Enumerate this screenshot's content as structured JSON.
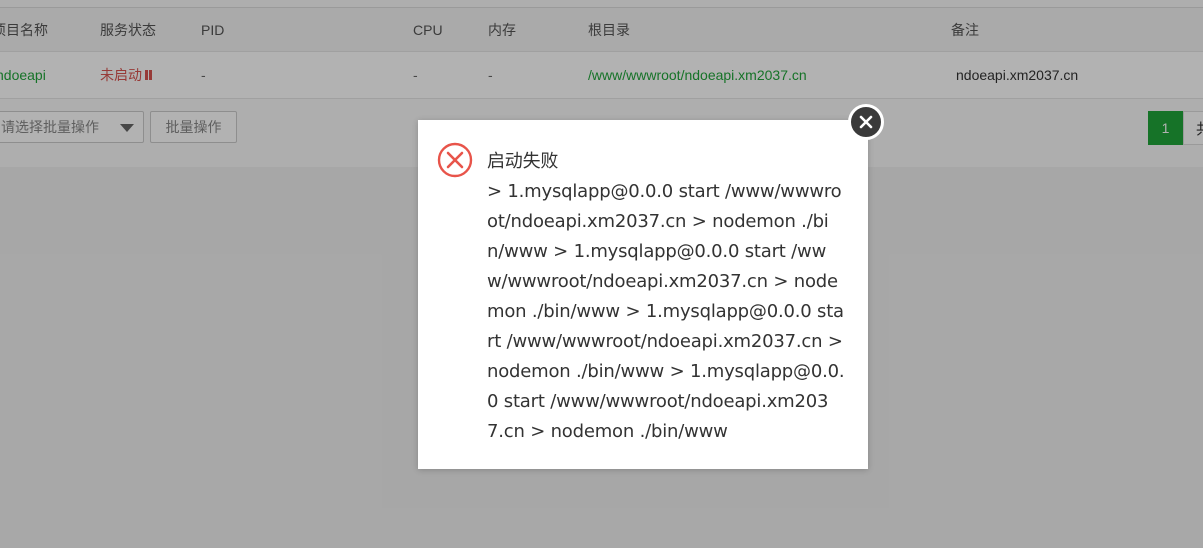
{
  "table": {
    "headers": {
      "name": "项目名称",
      "status": "服务状态",
      "pid": "PID",
      "cpu": "CPU",
      "memory": "内存",
      "root": "根目录",
      "remark": "备注"
    },
    "row": {
      "name": "ndoeapi",
      "status": "未启动",
      "pid": "-",
      "cpu": "-",
      "memory": "-",
      "root": "/www/wwwroot/ndoeapi.xm2037.cn",
      "remark": "ndoeapi.xm2037.cn"
    }
  },
  "toolbar": {
    "batch_select_placeholder": "请选择批量操作",
    "batch_button": "批量操作"
  },
  "pagination": {
    "current": "1",
    "total_prefix": "共"
  },
  "dialog": {
    "icon": "error-circle-x-icon",
    "title": "启动失败",
    "message": "> 1.mysqlapp@0.0.0 start /www/wwwroot/ndoeapi.xm2037.cn > nodemon ./bin/www > 1.mysqlapp@0.0.0 start /www/wwwroot/ndoeapi.xm2037.cn > nodemon ./bin/www > 1.mysqlapp@0.0.0 start /www/wwwroot/ndoeapi.xm2037.cn > nodemon ./bin/www > 1.mysqlapp@0.0.0 start /www/wwwroot/ndoeapi.xm2037.cn > nodemon ./bin/www"
  },
  "colors": {
    "accent_green": "#20a53a",
    "error_red": "#d9534f",
    "overlay": "rgba(0,0,0,0.30)"
  }
}
